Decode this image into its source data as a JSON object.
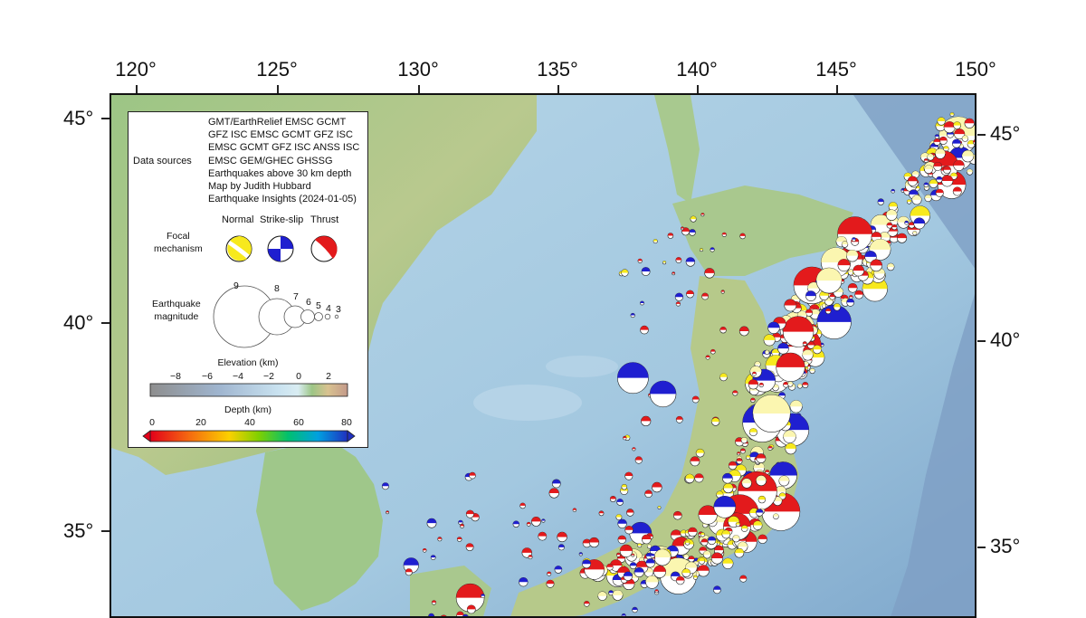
{
  "map": {
    "top_lon_labels": [
      "120°",
      "125°",
      "130°",
      "135°",
      "140°",
      "145°",
      "150°"
    ],
    "left_lat_labels": [
      "45°",
      "40°",
      "35°"
    ],
    "right_lat_labels": [
      "45°",
      "40°",
      "35°"
    ],
    "colors": {
      "ocean_deep": "#8fb6d6",
      "ocean_shallow": "#c8e1ef",
      "land_low": "#8fbf7a",
      "land_high": "#c9b27f",
      "thrust": "#e31a1c",
      "normal": "#f7e91d",
      "strike_slip": "#1f1fd0",
      "shallow_quake_fill": "#fbf6b0"
    }
  },
  "legend": {
    "data_sources_title": "Data sources",
    "data_sources_lines": [
      "GMT/EarthRelief EMSC GCMT",
      "GFZ ISC EMSC GCMT GFZ ISC",
      "EMSC GCMT GFZ ISC ANSS ISC",
      "EMSC GEM/GHEC GHSSG",
      "Earthquakes above 30 km depth",
      "Map by Judith Hubbard",
      "Earthquake Insights (2024-01-05)"
    ],
    "focal": {
      "title_line1": "Focal",
      "title_line2": "mechanism",
      "normal_label": "Normal",
      "strike_slip_label": "Strike-slip",
      "thrust_label": "Thrust"
    },
    "magnitude": {
      "title_line1": "Earthquake",
      "title_line2": "magnitude",
      "values": [
        "9",
        "8",
        "7",
        "6",
        "5",
        "4",
        "3"
      ]
    },
    "elevation": {
      "title": "Elevation (km)",
      "ticks": [
        "−8",
        "−6",
        "−4",
        "−2",
        "0",
        "2"
      ]
    },
    "depth": {
      "title": "Depth (km)",
      "ticks": [
        "0",
        "20",
        "40",
        "60",
        "80"
      ]
    }
  }
}
